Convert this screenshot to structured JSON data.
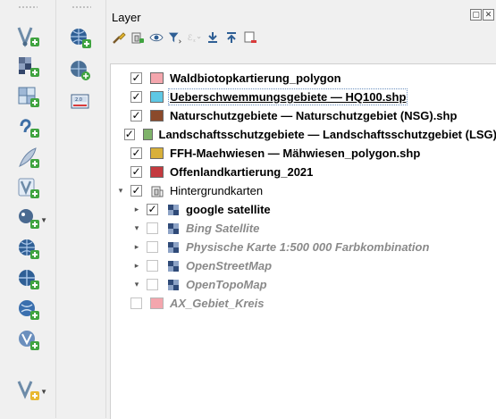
{
  "panel": {
    "title": "Layer",
    "float_ctrl": "▢",
    "close_ctrl": "✕"
  },
  "layers": [
    {
      "label": "Waldbiotopkartierung_polygon",
      "checked": true,
      "color": "#f4a6ad",
      "style": "bold"
    },
    {
      "label": "Ueberschwemmungsgebiete — HQ100.shp",
      "checked": true,
      "color": "#5ec8e5",
      "style": "bold-underline",
      "selected": true
    },
    {
      "label": "Naturschutzgebiete — Naturschutzgebiet (NSG).shp",
      "checked": true,
      "color": "#8b4a2b",
      "style": "bold"
    },
    {
      "label": "Landschaftsschutzgebiete — Landschaftsschutzgebiet (LSG)",
      "checked": true,
      "color": "#7fb36a",
      "style": "bold"
    },
    {
      "label": "FFH-Maehwiesen — Mähwiesen_polygon.shp",
      "checked": true,
      "color": "#d8b03a",
      "style": "bold"
    },
    {
      "label": "Offenlandkartierung_2021",
      "checked": true,
      "color": "#c43a3f",
      "style": "bold"
    }
  ],
  "group": {
    "label": "Hintergrundkarten",
    "checked": true,
    "expanded": true
  },
  "basemaps": [
    {
      "label": "google satellite",
      "checked": true,
      "arrow": "▸",
      "style": "bold"
    },
    {
      "label": "Bing Satellite",
      "checked": false,
      "arrow": "▾",
      "style": "italic"
    },
    {
      "label": "Physische Karte 1:500 000 Farbkombination",
      "checked": false,
      "arrow": "▸",
      "style": "italic"
    },
    {
      "label": "OpenStreetMap",
      "checked": false,
      "arrow": "▸",
      "style": "italic"
    },
    {
      "label": "OpenTopoMap",
      "checked": false,
      "arrow": "▾",
      "style": "italic"
    }
  ],
  "trailing_layer": {
    "label": "AX_Gebiet_Kreis",
    "checked": false,
    "color": "#f4a6ad",
    "style": "italic"
  },
  "checkmark": "✓",
  "icons": {
    "left_toolbar": [
      "new-vector-layer-icon",
      "new-raster-layer-icon",
      "new-virtual-layer-icon",
      "delimited-text-layer-icon",
      "spatialite-layer-icon",
      "new-geopackage-layer-icon",
      "add-postgis-layer-icon",
      "add-wms-layer-icon",
      "add-wfs-layer-icon",
      "add-wcs-layer-icon",
      "add-mesh-layer-icon"
    ],
    "right_toolbar": [
      "add-xyz-layer-icon",
      "add-vector-tile-icon",
      "metasearch-icon"
    ],
    "panel_tools": [
      "style-brush-icon",
      "add-group-icon",
      "visibility-eye-icon",
      "filter-icon",
      "expression-filter-icon",
      "expand-all-icon",
      "collapse-all-icon",
      "remove-layer-icon"
    ]
  }
}
